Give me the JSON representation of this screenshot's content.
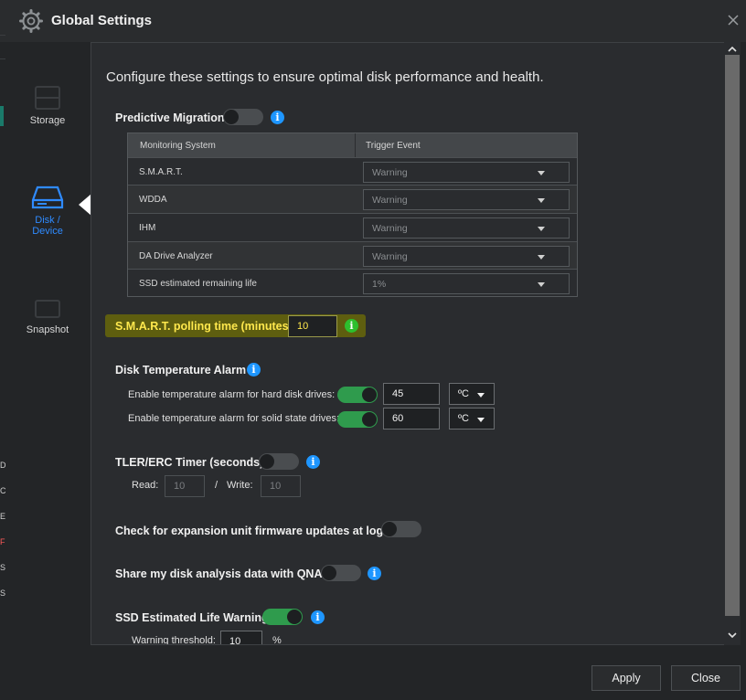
{
  "window": {
    "title": "Global Settings"
  },
  "left_fragments": [
    "D",
    "C",
    "E",
    "F",
    "S",
    "S"
  ],
  "sidebar": {
    "items": [
      {
        "label": "Storage"
      },
      {
        "label_line1": "Disk /",
        "label_line2": "Device"
      },
      {
        "label": "Snapshot"
      }
    ]
  },
  "content": {
    "intro": "Configure these settings to ensure optimal disk performance and health.",
    "predictive_migration": {
      "label": "Predictive Migration",
      "table": {
        "headers": [
          "Monitoring System",
          "Trigger Event"
        ],
        "rows": [
          {
            "name": "S.M.A.R.T.",
            "value": "Warning"
          },
          {
            "name": "WDDA",
            "value": "Warning"
          },
          {
            "name": "IHM",
            "value": "Warning"
          },
          {
            "name": "DA Drive Analyzer",
            "value": "Warning"
          },
          {
            "name": "SSD estimated remaining life",
            "value": "1%"
          }
        ]
      }
    },
    "smart_polling": {
      "label": "S.M.A.R.T. polling time (minutes)",
      "value": "10"
    },
    "temperature_alarm": {
      "label": "Disk Temperature Alarm",
      "hdd_label": "Enable temperature alarm for hard disk drives:",
      "hdd_value": "45",
      "hdd_unit": "ºC",
      "ssd_label": "Enable temperature alarm for solid state drives:",
      "ssd_value": "60",
      "ssd_unit": "ºC"
    },
    "tler": {
      "label": "TLER/ERC Timer (seconds)",
      "read_label": "Read:",
      "read_value": "10",
      "separator": "/",
      "write_label": "Write:",
      "write_value": "10"
    },
    "expansion_fw": {
      "label": "Check for expansion unit firmware updates at login"
    },
    "share_data": {
      "label": "Share my disk analysis data with QNAP"
    },
    "ssd_life_warning": {
      "label": "SSD Estimated Life Warning",
      "threshold_label": "Warning threshold:",
      "threshold_value": "10",
      "unit": "%"
    }
  },
  "footer": {
    "apply_label": "Apply",
    "close_label": "Close"
  },
  "colors": {
    "accent": "#2f8bff",
    "toggle_on": "#2f9b4d",
    "info": "#1e96ff",
    "highlight": "#5e5e0f"
  }
}
